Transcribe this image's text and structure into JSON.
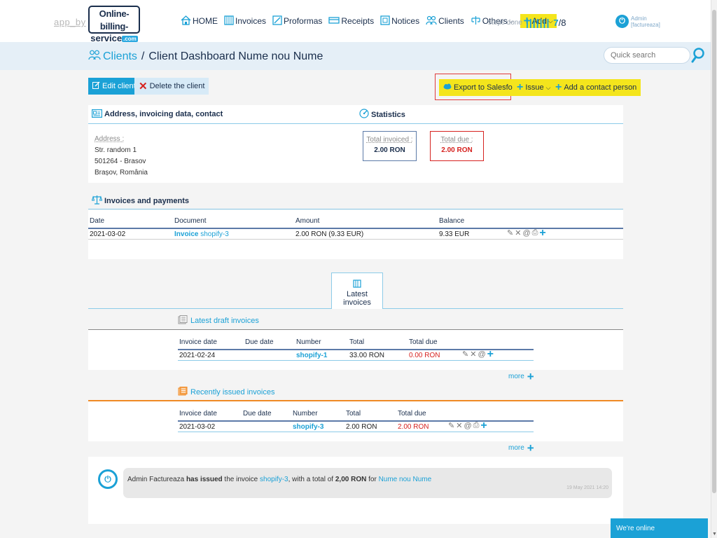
{
  "header": {
    "app_by": "app_by",
    "logo_line1": "Online-billing-",
    "logo_line2": "service",
    "logo_com": ".com",
    "nav": [
      {
        "label": "HOME",
        "icon": "home-icon"
      },
      {
        "label": "Invoices",
        "icon": "invoices-icon"
      },
      {
        "label": "Proformas",
        "icon": "proformas-icon"
      },
      {
        "label": "Receipts",
        "icon": "receipts-icon"
      },
      {
        "label": "Notices",
        "icon": "notices-icon"
      },
      {
        "label": "Clients",
        "icon": "clients-icon"
      },
      {
        "label": "Others",
        "icon": "others-icon"
      }
    ],
    "add_label": "Add",
    "steps_label": "steps done",
    "steps_bars": "|||||||",
    "steps_current": "7",
    "steps_total": "/8",
    "admin_name": "Admin",
    "admin_company": "[factureaza]"
  },
  "breadcrumb": {
    "clients": "Clients",
    "separator": "/",
    "current": "Client Dashboard Nume nou Nume"
  },
  "search": {
    "placeholder": "Quick search"
  },
  "toolbar": {
    "edit": "Edit client",
    "delete": "Delete the client",
    "export": "Export to Salesforce",
    "issue": "Issue",
    "add_contact": "Add a contact person"
  },
  "address_section": {
    "title": "Address, invoicing data, contact",
    "label": "Address :",
    "lines": [
      "Str. random 1",
      "501264 - Brasov",
      "Brașov, România"
    ]
  },
  "statistics": {
    "title": "Statistics",
    "total_invoiced_label": "Total invoiced :",
    "total_invoiced_value": "2.00 RON",
    "total_due_label": "Total due :",
    "total_due_value": "2.00 RON"
  },
  "payments": {
    "title": "Invoices and payments",
    "columns": [
      "Date",
      "Document",
      "Amount",
      "Balance"
    ],
    "rows": [
      {
        "date": "2021-03-02",
        "doc_type": "Invoice",
        "doc_number": "shopify-3",
        "amount": "2.00 RON (9.33 EUR)",
        "balance": "9.33 EUR"
      }
    ]
  },
  "latest_tab": {
    "label": "Latest invoices"
  },
  "drafts": {
    "title": "Latest draft invoices",
    "columns": [
      "Invoice date",
      "Due date",
      "Number",
      "Total",
      "Total due"
    ],
    "rows": [
      {
        "date": "2021-02-24",
        "due": "",
        "number": "shopify-1",
        "total": "33.00 RON",
        "total_due": "0.00 RON"
      }
    ],
    "more": "more"
  },
  "issued": {
    "title": "Recently issued invoices",
    "columns": [
      "Invoice date",
      "Due date",
      "Number",
      "Total",
      "Total due"
    ],
    "rows": [
      {
        "date": "2021-03-02",
        "due": "",
        "number": "shopify-3",
        "total": "2.00 RON",
        "total_due": "2.00 RON"
      }
    ],
    "more": "more"
  },
  "activity": {
    "actor": "Admin Factureaza",
    "action": "has issued",
    "mid": "the invoice",
    "invoice": "shopify-3",
    "mid2": ", with a total of",
    "amount": "2,00 RON",
    "for": "for",
    "client": "Nume nou Nume",
    "time": "19 May 2021 14:20"
  },
  "chat": {
    "label": "We're online"
  },
  "colors": {
    "brand_blue": "#1ba1d6",
    "navy": "#1a2e4c",
    "yellow": "#f4e51c",
    "red": "#d6221f",
    "orange": "#f08a24"
  }
}
